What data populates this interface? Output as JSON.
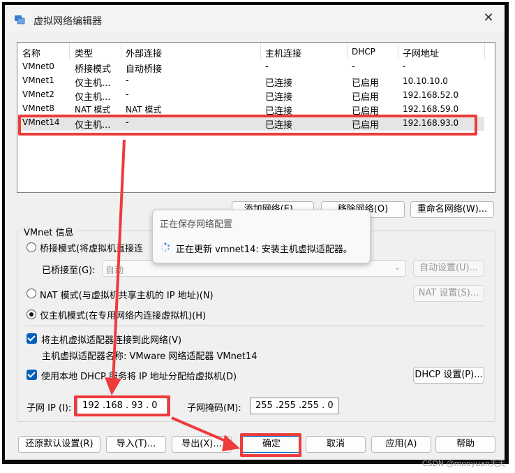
{
  "window": {
    "title": "虚拟网络编辑器",
    "close_glyph": "✕",
    "app_icon": "vmware-network-icon"
  },
  "network_table": {
    "headers": [
      "名称",
      "类型",
      "外部连接",
      "主机连接",
      "DHCP",
      "子网地址"
    ],
    "rows": [
      [
        "VMnet0",
        "桥接模式",
        "自动桥接",
        "-",
        "-",
        "-"
      ],
      [
        "VMnet1",
        "仅主机...",
        "-",
        "已连接",
        "已启用",
        "10.10.10.0"
      ],
      [
        "VMnet2",
        "仅主机...",
        "-",
        "已连接",
        "已启用",
        "192.168.52.0"
      ],
      [
        "VMnet8",
        "NAT 模式",
        "NAT 模式",
        "已连接",
        "已启用",
        "192.168.59.0"
      ],
      [
        "VMnet14",
        "仅主机...",
        "-",
        "已连接",
        "已启用",
        "192.168.93.0"
      ]
    ],
    "selected_row": 4
  },
  "table_buttons": {
    "add": "添加网络(E)...",
    "remove": "移除网络(O)",
    "rename": "重命名网络(W)..."
  },
  "vmnet_info": {
    "group_title": "VMnet 信息",
    "bridged_label": "桥接模式(将虚拟机直接连",
    "bridged_to_label": "已桥接至(G):",
    "bridged_to_value": "自动",
    "auto_settings": "自动设置(U)...",
    "nat_label": "NAT 模式(与虚拟机共享主机的 IP 地址)(N)",
    "nat_settings": "NAT 设置(S)...",
    "host_only_label": "仅主机模式(在专用网络内连接虚拟机)(H)",
    "selected_mode": "host-only",
    "connect_adapter_label": "将主机虚拟适配器连接到此网络(V)",
    "adapter_name_label": "主机虚拟适配器名称: VMware 网络适配器 VMnet14",
    "dhcp_label": "使用本地 DHCP 服务将 IP 地址分配给虚拟机(D)",
    "dhcp_settings": "DHCP 设置(P)...",
    "subnet_ip_label": "子网 IP (I):",
    "subnet_ip_value": "192 .168 . 93 . 0",
    "subnet_mask_label": "子网掩码(M):",
    "subnet_mask_value": "255 .255 .255 . 0"
  },
  "footer_buttons": {
    "restore": "还原默认设置(R)",
    "import": "导入(T)...",
    "export": "导出(X)...",
    "ok": "确定",
    "cancel": "取消",
    "apply": "应用(A)",
    "help": "帮助"
  },
  "progress_popup": {
    "title": "正在保存网络配置",
    "message": "正在更新 vmnet14: 安装主机虚拟适配器。",
    "spinner_icon": "loading-spinner-icon"
  },
  "watermark": "CSDN @mooyuan天天",
  "annotation_color": "#ee3b3b"
}
